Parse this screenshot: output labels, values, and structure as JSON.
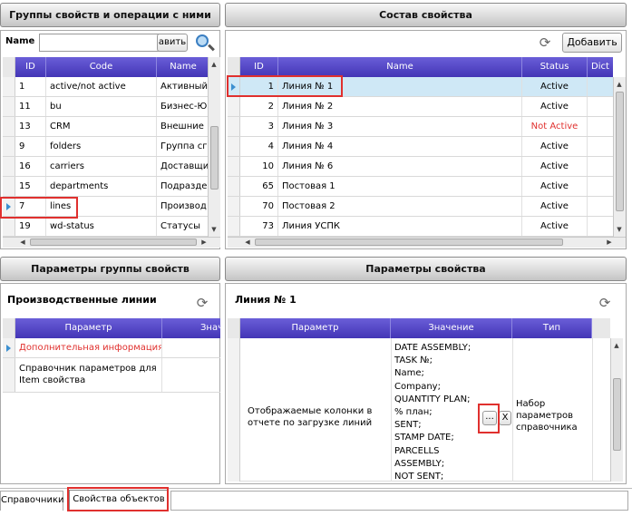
{
  "left_top": {
    "title": "Группы свойств и операции с ними",
    "search_label": "Name",
    "search_value": "",
    "search_button_label": "авить",
    "columns": [
      "ID",
      "Code",
      "Name"
    ],
    "rows": [
      {
        "id": "1",
        "code": "active/not active",
        "name": "Активный"
      },
      {
        "id": "11",
        "code": "bu",
        "name": "Бизнес-Ю"
      },
      {
        "id": "13",
        "code": "CRM",
        "name": "Внешние"
      },
      {
        "id": "9",
        "code": "folders",
        "name": "Группа сг"
      },
      {
        "id": "16",
        "code": "carriers",
        "name": "Доставщи"
      },
      {
        "id": "15",
        "code": "departments",
        "name": "Подразде"
      },
      {
        "id": "7",
        "code": "lines",
        "name": "Производ"
      },
      {
        "id": "19",
        "code": "wd-status",
        "name": "Статусы"
      }
    ]
  },
  "right_top": {
    "title": "Состав свойства",
    "add_label": "Добавить",
    "columns": [
      "ID",
      "Name",
      "Status",
      "Dict"
    ],
    "rows": [
      {
        "id": "1",
        "name": "Линия № 1",
        "status": "Active"
      },
      {
        "id": "2",
        "name": "Линия № 2",
        "status": "Active"
      },
      {
        "id": "3",
        "name": "Линия № 3",
        "status": "Not Active"
      },
      {
        "id": "4",
        "name": "Линия № 4",
        "status": "Active"
      },
      {
        "id": "10",
        "name": "Линия № 6",
        "status": "Active"
      },
      {
        "id": "65",
        "name": "Постовая 1",
        "status": "Active"
      },
      {
        "id": "70",
        "name": "Постовая 2",
        "status": "Active"
      },
      {
        "id": "73",
        "name": "Линия УСПК",
        "status": "Active"
      }
    ]
  },
  "left_bottom": {
    "title": "Параметры группы свойств",
    "subtitle": "Производственные линии",
    "columns": [
      "Параметр",
      "Значе"
    ],
    "rows": [
      {
        "param": "Дополнительная информация"
      },
      {
        "param": "Справочник параметров для Item свойства"
      }
    ]
  },
  "right_bottom": {
    "title": "Параметры свойства",
    "subtitle": "Линия № 1",
    "columns": [
      "Параметр",
      "Значение",
      "Тип"
    ],
    "row": {
      "param": "Отображаемые колонки в отчете по загрузке линий",
      "values": [
        "DATE ASSEMBLY;",
        "TASK №;",
        "Name;",
        "Company;",
        "QUANTITY PLAN;",
        "% план;",
        "SENT;",
        "STAMP DATE;",
        "PARCELLS",
        "ASSEMBLY;",
        "NOT SENT;"
      ],
      "browse_label": "...",
      "clear_label": "X",
      "type": "Набор параметров справочника"
    }
  },
  "tabs": [
    "Справочники",
    "Свойства объектов"
  ],
  "colors": {
    "header": "#4335b6",
    "selected": "#cfe8f6",
    "inactive": "#e0302e",
    "highlight": "#e0302e"
  },
  "icons": [
    "refresh-icon",
    "search-icon",
    "row-arrow-icon"
  ]
}
